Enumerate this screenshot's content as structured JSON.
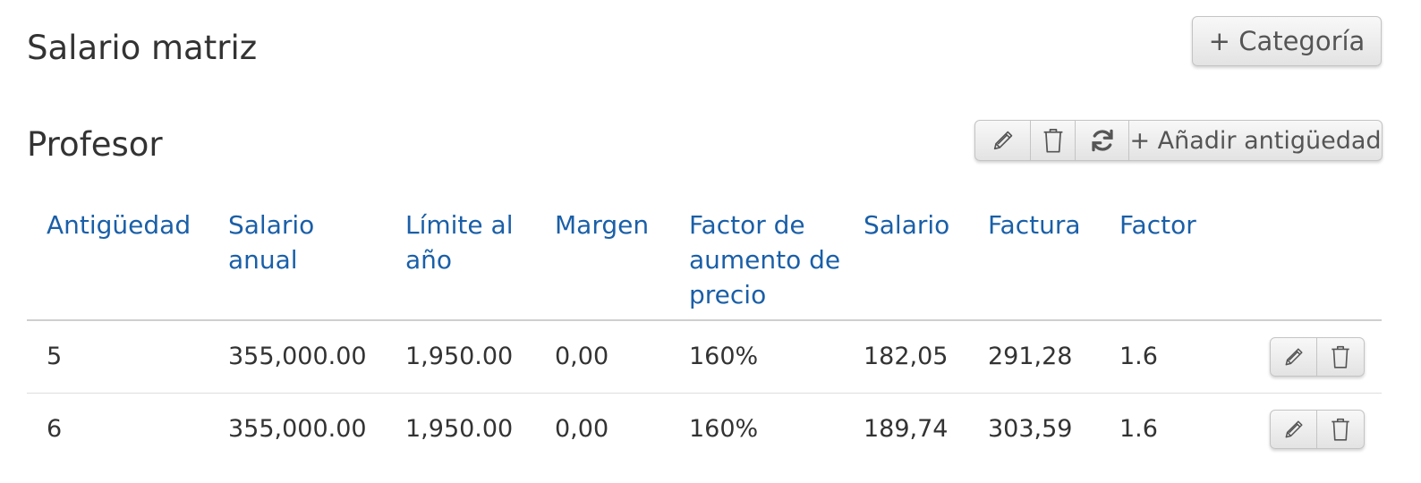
{
  "page": {
    "title": "Salario matriz",
    "add_category_label": "+ Categoría"
  },
  "category": {
    "title": "Profesor",
    "toolbar": {
      "edit_icon": "pencil-icon",
      "delete_icon": "trash-icon",
      "refresh_icon": "refresh-icon",
      "add_seniority_label": "+ Añadir antigüedad"
    }
  },
  "table": {
    "columns": [
      "Antigüedad",
      "Salario anual",
      "Límite al año",
      "Margen",
      "Factor de aumento de precio",
      "Salario",
      "Factura",
      "Factor"
    ],
    "rows": [
      [
        "5",
        "355,000.00",
        "1,950.00",
        "0,00",
        "160%",
        "182,05",
        "291,28",
        "1.6"
      ],
      [
        "6",
        "355,000.00",
        "1,950.00",
        "0,00",
        "160%",
        "189,74",
        "303,59",
        "1.6"
      ]
    ]
  },
  "colors": {
    "header_text": "#1a5fa8",
    "body_text": "#333333",
    "button_text": "#555555"
  }
}
